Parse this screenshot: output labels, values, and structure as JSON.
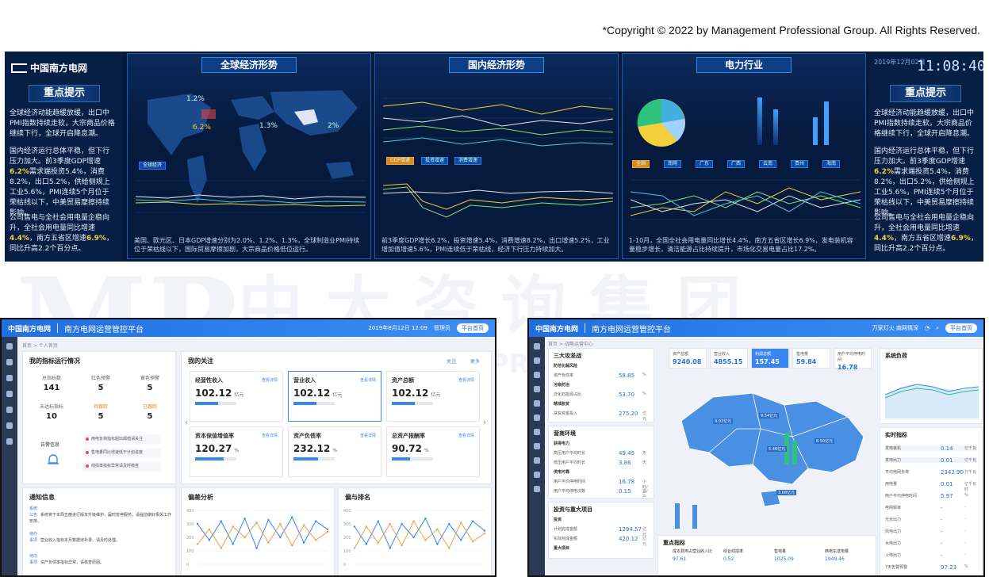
{
  "copyright": "*Copyright © 2022 by Management Professional Group. All Rights Reserved.",
  "watermark": {
    "logo": "MP",
    "cn": "中 大 咨 询 集 团",
    "en": "MANAGEMENT PROFESSIONAL GROUP"
  },
  "top_dashboard": {
    "logo_text": "中国南方电网",
    "date_text": "2019年12月02日",
    "clock": "11:08:40",
    "hint_title": "重点提示",
    "hint_p1": "全球经济动能趋缓放缓，出口中PMI指数持续走软，大宗商品价格继续下行，全球开启降息潮。",
    "hint_p2_a": "国内经济运行总体平稳，但下行压力加大。前3季度GDP增速",
    "hint_p2_hl": "6.2%",
    "hint_p2_b": "需求端投资5.4%，消费8.2%，出口5.2%，供给侧规上工业5.6%，PMI连续5个月位于荣枯线以下，中美贸易摩擦持续影响。",
    "hint_p3_a": "公司售电与全社会用电量企稳向升，全社会用电量同比增速",
    "hint_p3_hl1": "4.4%",
    "hint_p3_b": "，南方五省区增速",
    "hint_p3_hl2": "6.9%",
    "hint_p3_c": "，同比升高2.2个百分点。",
    "panels": [
      {
        "title": "全球经济形势",
        "foot": "美国、欧元区、日本GDP增速分别为2.0%、1.2%、1.3%，全球制造业PMI持续位于荣枯线以下，国际贸易摩擦加剧，大宗商品价格低位运行。"
      },
      {
        "title": "国内经济形势",
        "foot": "前3季度GDP增长6.2%，投资增速5.4%，消费增速8.2%，出口增速5.2%，工业增加值增速5.6%，PMI连续低于荣枯线，经济下行压力持续加大。"
      },
      {
        "title": "电力行业",
        "foot": "1-10月，全国全社会用电量同比增长4.4%，南方五省区增长6.9%，发电装机容量稳步增长，清洁能源占比持续提升，市场化交易电量占比17.2%。"
      }
    ],
    "map_labels": [
      "1.2%",
      "6.2%",
      "1.3%",
      "2%"
    ],
    "map_button": "全球经济",
    "domestic_tabs": [
      "GDP增速",
      "投资增速",
      "消费增速"
    ],
    "power_tabs": [
      "全国",
      "南网",
      "广东",
      "广西",
      "云南",
      "贵州",
      "海南"
    ]
  },
  "window_left": {
    "brand": "中国南方电网",
    "title": "南方电网运营管控平台",
    "datetime": "2019年8月12日 12:09",
    "user": "管理员",
    "home_btn": "平台首页",
    "breadcrumb": "首页 > 个人首页",
    "run_title": "我的指标运行情况",
    "stats_row1": [
      {
        "label": "总指标数",
        "value": "141"
      },
      {
        "label": "红色预警",
        "value": "5"
      },
      {
        "label": "黄色预警",
        "value": "5"
      }
    ],
    "stats_row2": [
      {
        "label": "未达标指标",
        "value": "10"
      },
      {
        "label": "待跟踪",
        "value": "5"
      },
      {
        "label": "已跟踪",
        "value": "5"
      }
    ],
    "alarm_label": "告警信息",
    "alarms": [
      "用电负荷指标超出阈值请关注",
      "售电量同比增速低于计划进度",
      "线损率指标异常请及时核查"
    ],
    "focus_title": "我的关注",
    "focus_actions": [
      "关注",
      "更多"
    ],
    "kpis": [
      {
        "title": "经营性收入",
        "value": "102.12",
        "unit": "亿元",
        "fill": 0.55,
        "badge": "查看详情"
      },
      {
        "title": "营业收入",
        "value": "102.12",
        "unit": "亿元",
        "fill": 0.55,
        "badge": "查看详情"
      },
      {
        "title": "资产总额",
        "value": "102.12",
        "unit": "亿元",
        "fill": 0.55,
        "badge": "查看详情"
      },
      {
        "title": "资本保值增值率",
        "value": "120.27",
        "unit": "%",
        "fill": 0.7,
        "badge": "查看详情"
      },
      {
        "title": "资产负债率",
        "value": "232.12",
        "unit": "%",
        "fill": 0.6,
        "badge": "查看详情"
      },
      {
        "title": "总资产报酬率",
        "value": "90.72",
        "unit": "%",
        "fill": 0.45,
        "badge": "查看详情"
      }
    ],
    "notice_title": "通知信息",
    "notices": [
      {
        "tag": "系统公告",
        "text": "系统将于本周五晚进行版本升级维护，届时暂停服务，请提前做好相关工作安排。"
      },
      {
        "tag": "待办事项",
        "text": "营业收入指标本月数据待补录，请及时处理。"
      },
      {
        "tag": "待办事项",
        "text": "资产负债率指标异常，请核查原因。"
      }
    ],
    "chart1_title": "偏差分析",
    "chart2_title": "偏与排名"
  },
  "window_right": {
    "brand": "中国南方电网",
    "title": "南方电网运营管控平台",
    "user": "万家灯火 南网情深",
    "home_btn": "平台首页",
    "breadcrumb": "首页 > 战略运营中心",
    "s1": "三大攻坚战",
    "s1_rows": [
      {
        "label": "防范化解风险",
        "value": "",
        "unit": ""
      },
      {
        "label": "资产负债率",
        "value": "58.85",
        "unit": "%"
      },
      {
        "label": "污染防治",
        "value": "",
        "unit": ""
      },
      {
        "label": "非化石能源占比",
        "value": "53.70",
        "unit": "%"
      },
      {
        "label": "精准脱贫",
        "value": "",
        "unit": ""
      },
      {
        "label": "扶贫资金投入",
        "value": "275.20",
        "unit": "亿元"
      }
    ],
    "s2": "营商环境",
    "s2_rows": [
      {
        "label": "获得电力",
        "value": "",
        "unit": ""
      },
      {
        "label": "高压用户平均时长",
        "value": "49.45",
        "unit": "天"
      },
      {
        "label": "低压用户平均时长",
        "value": "3.86",
        "unit": "天"
      },
      {
        "label": "供电可靠",
        "value": "",
        "unit": ""
      },
      {
        "label": "用户平均停电时间",
        "value": "16.78",
        "unit": "小时/户"
      },
      {
        "label": "用户平均停电次数",
        "value": "0.15",
        "unit": "次/户"
      }
    ],
    "s3": "投资与重大项目",
    "s3_rows": [
      {
        "label": "投资",
        "value": "",
        "unit": ""
      },
      {
        "label": "计划完成金额",
        "value": "1294.57",
        "unit": "亿元"
      },
      {
        "label": "实际完成金额",
        "value": "420.12",
        "unit": "亿元"
      },
      {
        "label": "重大项目",
        "value": "",
        "unit": ""
      }
    ],
    "tiles": [
      {
        "label": "资产总额",
        "value": "9240.08"
      },
      {
        "label": "营业收入",
        "value": "4855.15"
      },
      {
        "label": "利润总额",
        "value": "157.45"
      },
      {
        "label": "售电量",
        "value": "59.84"
      },
      {
        "label": "用户平均停电时间",
        "value": "16.78"
      }
    ],
    "map_labels": [
      "9.02亿元",
      "9.54亿元",
      "5.46亿元",
      "8.50亿元",
      "3.08亿元"
    ],
    "focus_title": "重点指标",
    "focus_cols": [
      "成本费用占营业收入比",
      "综合线损率",
      "售电量",
      "西电东送电量"
    ],
    "focus_vals": [
      "97.61",
      "0.52",
      "1025.09",
      "1949.46"
    ],
    "load_title": "系统负荷",
    "rt_title": "实时指标",
    "rt_rows": [
      {
        "label": "发电装机",
        "value": "0.14",
        "unit": "亿千瓦"
      },
      {
        "label": "发电出力",
        "value": "0.01",
        "unit": "亿千瓦"
      },
      {
        "label": "平均电网负荷",
        "value": "2342.90",
        "unit": "万千瓦"
      },
      {
        "label": "用电量",
        "value": "0.01",
        "unit": "亿千瓦时"
      },
      {
        "label": "用户平均停电时间",
        "value": "5.97",
        "unit": "%"
      },
      {
        "label": "电网频率",
        "value": "-",
        "unit": "-"
      },
      {
        "label": "光伏出力",
        "value": "-",
        "unit": "-"
      },
      {
        "label": "风电出力",
        "value": "-",
        "unit": "-"
      },
      {
        "label": "水电出力",
        "value": "-",
        "unit": "-"
      },
      {
        "label": "火电出力",
        "value": "-",
        "unit": "-"
      },
      {
        "label": "7天告警预警",
        "value": "97.23",
        "unit": "%"
      }
    ]
  },
  "chart_data": [
    {
      "type": "line",
      "title": "偏差分析",
      "categories": [
        "1",
        "2",
        "3",
        "4",
        "5",
        "6",
        "7",
        "8",
        "9",
        "10",
        "11",
        "12"
      ],
      "series": [
        {
          "name": "",
          "values": [
            300,
            180,
            320,
            150,
            340,
            120,
            330,
            200,
            350,
            160,
            320,
            260
          ]
        },
        {
          "name": "",
          "values": [
            150,
            260,
            120,
            280,
            200,
            310,
            160,
            300,
            140,
            290,
            180,
            240
          ]
        }
      ],
      "ylim": [
        0,
        400
      ]
    },
    {
      "type": "line",
      "title": "偏与排名",
      "categories": [
        "1",
        "2",
        "3",
        "4",
        "5",
        "6",
        "7",
        "8",
        "9",
        "10",
        "11",
        "12"
      ],
      "series": [
        {
          "name": "",
          "values": [
            280,
            150,
            320,
            120,
            300,
            200,
            340,
            150,
            300,
            180,
            320,
            250
          ]
        },
        {
          "name": "",
          "values": [
            120,
            280,
            160,
            300,
            140,
            320,
            180,
            260,
            120,
            310,
            170,
            230
          ]
        }
      ],
      "ylim": [
        0,
        400
      ]
    }
  ]
}
